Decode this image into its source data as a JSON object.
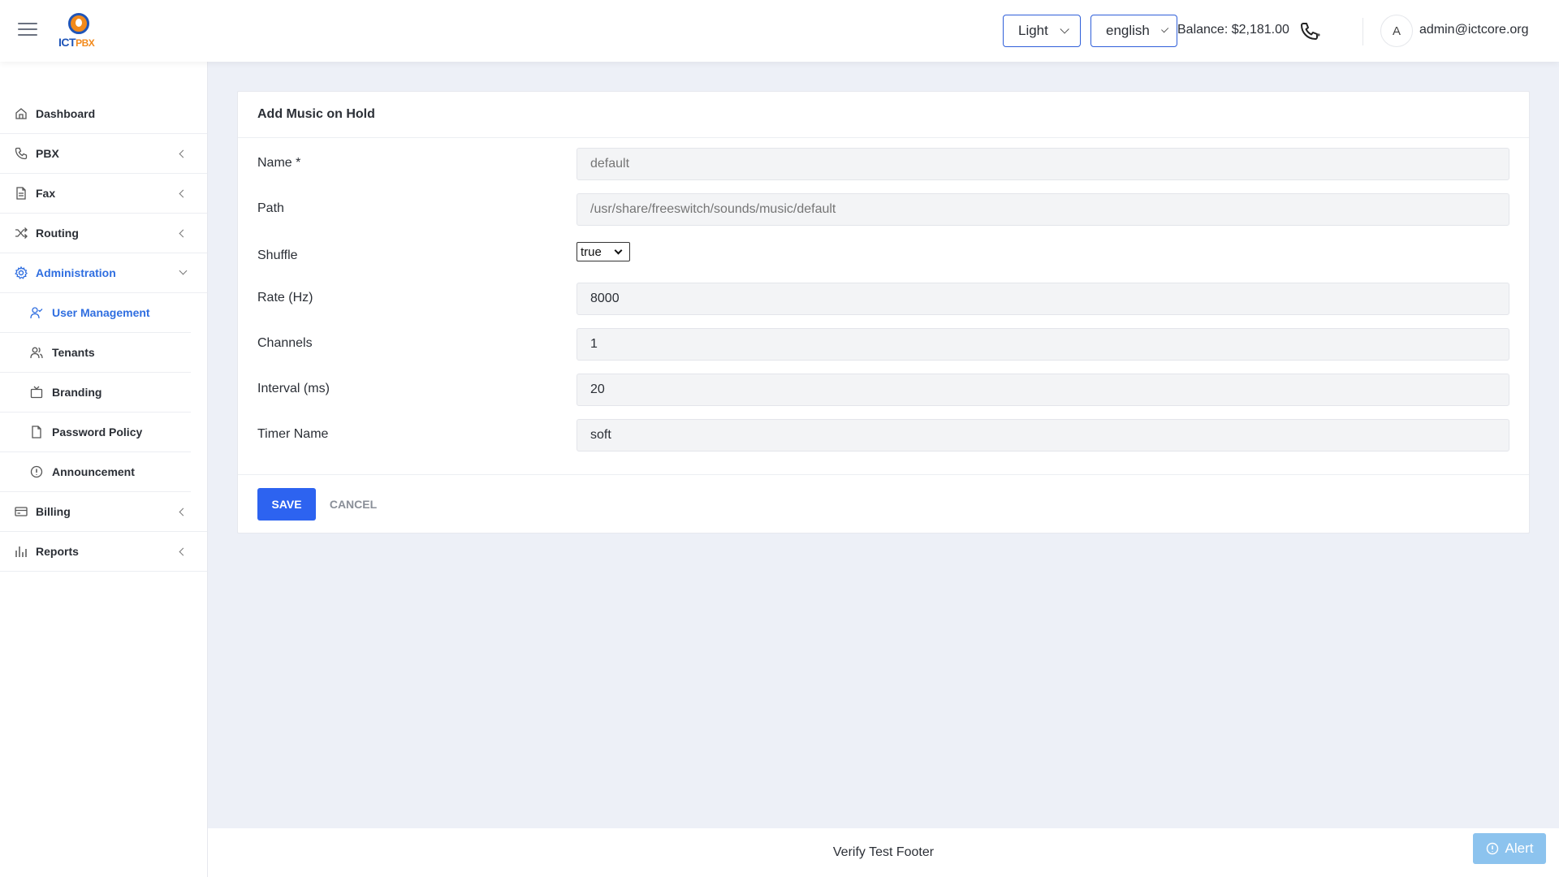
{
  "header": {
    "menu_icon": "hamburger-icon",
    "logo_text_main": "ICT",
    "logo_text_accent": "PBX",
    "theme": {
      "value": "Light"
    },
    "language": {
      "value": "english"
    },
    "balance": "Balance: $2,181.00",
    "phone_icon": "phone-icon",
    "avatar_initial": "A",
    "user_email": "admin@ictcore.org"
  },
  "sidebar": {
    "items": [
      {
        "label": "Dashboard",
        "icon": "home-icon"
      },
      {
        "label": "PBX",
        "icon": "phone-icon"
      },
      {
        "label": "Fax",
        "icon": "document-icon"
      },
      {
        "label": "Routing",
        "icon": "shuffle-icon"
      },
      {
        "label": "Administration",
        "icon": "gear-icon"
      },
      {
        "label": "Billing",
        "icon": "credit-card-icon"
      },
      {
        "label": "Reports",
        "icon": "bar-chart-icon"
      }
    ],
    "admin_sub": [
      {
        "label": "User Management",
        "icon": "user-check-icon"
      },
      {
        "label": "Tenants",
        "icon": "users-icon"
      },
      {
        "label": "Branding",
        "icon": "tv-icon"
      },
      {
        "label": "Password Policy",
        "icon": "file-icon"
      },
      {
        "label": "Announcement",
        "icon": "alert-circle-icon"
      }
    ]
  },
  "form": {
    "title": "Add Music on Hold",
    "fields": {
      "name": {
        "label": "Name *",
        "placeholder": "default"
      },
      "path": {
        "label": "Path",
        "placeholder": "/usr/share/freeswitch/sounds/music/default"
      },
      "shuffle": {
        "label": "Shuffle",
        "value": "true"
      },
      "rate": {
        "label": "Rate (Hz)",
        "value": "8000"
      },
      "channels": {
        "label": "Channels",
        "value": "1"
      },
      "interval": {
        "label": "Interval (ms)",
        "value": "20"
      },
      "timer": {
        "label": "Timer Name",
        "value": "soft"
      }
    },
    "save_label": "SAVE",
    "cancel_label": "CANCEL"
  },
  "footer": {
    "text": "Verify Test Footer",
    "alert_label": "Alert"
  },
  "colors": {
    "accent": "#2d63f0",
    "active_nav": "#2f6ee0",
    "page_bg": "#edf0f7",
    "alert_bg": "#8cc3ee"
  }
}
